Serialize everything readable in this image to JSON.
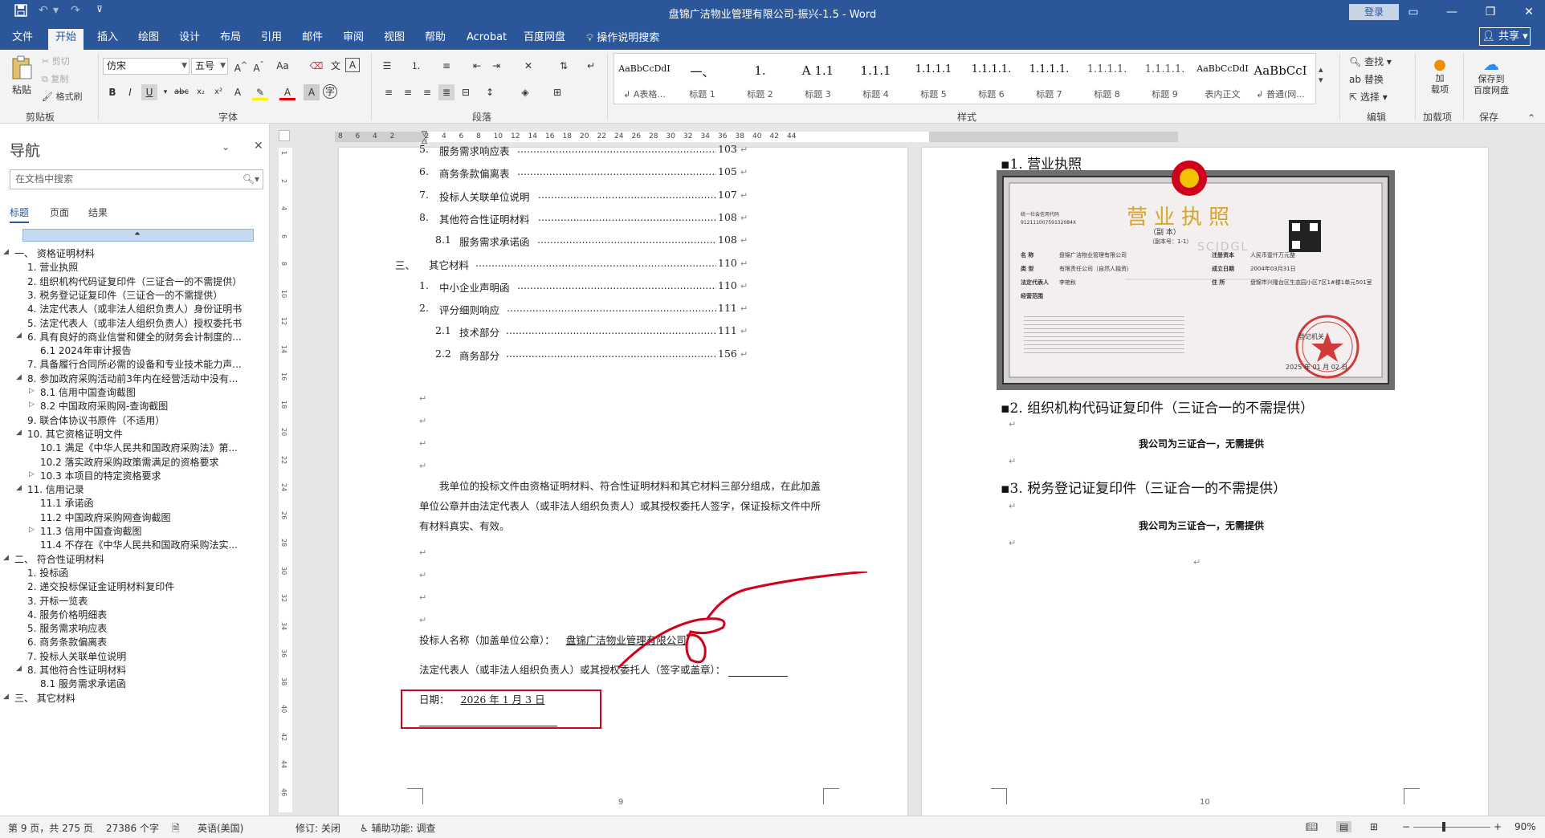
{
  "window": {
    "title": "盘锦广洁物业管理有限公司-振兴-1.5  -  Word",
    "login": "登录",
    "share": "共享"
  },
  "tabs": [
    "文件",
    "开始",
    "插入",
    "绘图",
    "设计",
    "布局",
    "引用",
    "邮件",
    "审阅",
    "视图",
    "帮助",
    "Acrobat",
    "百度网盘"
  ],
  "tell_me": "操作说明搜索",
  "ribbon": {
    "clipboard": {
      "paste": "粘贴",
      "cut": "剪切",
      "copy": "复制",
      "format_painter": "格式刷",
      "label": "剪贴板"
    },
    "font": {
      "name": "仿宋",
      "size": "五号",
      "label": "字体"
    },
    "paragraph": {
      "label": "段落"
    },
    "styles": {
      "label": "样式",
      "items": [
        {
          "preview": "AaBbCcDdI",
          "name": "↲ A表格..."
        },
        {
          "preview": "一、",
          "name": "标题 1"
        },
        {
          "preview": "1.",
          "name": "标题 2"
        },
        {
          "preview": "A 1.1",
          "name": "标题 3"
        },
        {
          "preview": "1.1.1",
          "name": "标题 4"
        },
        {
          "preview": "1.1.1.1",
          "name": "标题 5"
        },
        {
          "preview": "1.1.1.1.",
          "name": "标题 6"
        },
        {
          "preview": "1.1.1.1.",
          "name": "标题 7"
        },
        {
          "preview": "1.1.1.1.",
          "name": "标题 8"
        },
        {
          "preview": "1.1.1.1.",
          "name": "标题 9"
        },
        {
          "preview": "AaBbCcDdI",
          "name": "表内正文"
        },
        {
          "preview": "AaBbCcI",
          "name": "↲ 普通(网..."
        }
      ]
    },
    "editing": {
      "find": "查找",
      "replace": "替换",
      "select": "选择",
      "label": "编辑"
    },
    "addins": {
      "name": "加\n载项",
      "label": "加载项"
    },
    "save": {
      "name": "保存到\n百度网盘",
      "label": "保存"
    }
  },
  "nav": {
    "title": "导航",
    "search_placeholder": "在文档中搜索",
    "tabs": [
      "标题",
      "页面",
      "结果"
    ],
    "items": [
      {
        "text": "一、 资格证明材料",
        "level": 0,
        "expand": "down"
      },
      {
        "text": "1. 营业执照",
        "level": 1,
        "expand": ""
      },
      {
        "text": "2. 组织机构代码证复印件（三证合一的不需提供）",
        "level": 1,
        "expand": ""
      },
      {
        "text": "3. 税务登记证复印件（三证合一的不需提供）",
        "level": 1,
        "expand": ""
      },
      {
        "text": "4. 法定代表人（或非法人组织负责人）身份证明书",
        "level": 1,
        "expand": ""
      },
      {
        "text": "5. 法定代表人（或非法人组织负责人）授权委托书",
        "level": 1,
        "expand": ""
      },
      {
        "text": "6. 具有良好的商业信誉和健全的财务会计制度的...",
        "level": 1,
        "expand": "down"
      },
      {
        "text": "6.1 2024年审计报告",
        "level": 2,
        "expand": ""
      },
      {
        "text": "7. 具备履行合同所必需的设备和专业技术能力声...",
        "level": 1,
        "expand": ""
      },
      {
        "text": "8. 参加政府采购活动前3年内在经营活动中没有...",
        "level": 1,
        "expand": "down"
      },
      {
        "text": "8.1 信用中国查询截图",
        "level": 2,
        "expand": "right"
      },
      {
        "text": "8.2 中国政府采购网-查询截图",
        "level": 2,
        "expand": "right"
      },
      {
        "text": "9. 联合体协议书原件（不适用）",
        "level": 1,
        "expand": ""
      },
      {
        "text": "10. 其它资格证明文件",
        "level": 1,
        "expand": "down"
      },
      {
        "text": "10.1 满足《中华人民共和国政府采购法》第...",
        "level": 2,
        "expand": ""
      },
      {
        "text": "10.2 落实政府采购政策需满足的资格要求",
        "level": 2,
        "expand": ""
      },
      {
        "text": "10.3 本项目的特定资格要求",
        "level": 2,
        "expand": "right"
      },
      {
        "text": "11. 信用记录",
        "level": 1,
        "expand": "down"
      },
      {
        "text": "11.1 承诺函",
        "level": 2,
        "expand": ""
      },
      {
        "text": "11.2 中国政府采购网查询截图",
        "level": 2,
        "expand": ""
      },
      {
        "text": "11.3 信用中国查询截图",
        "level": 2,
        "expand": "right"
      },
      {
        "text": "11.4 不存在《中华人民共和国政府采购法实...",
        "level": 2,
        "expand": ""
      },
      {
        "text": "二、 符合性证明材料",
        "level": 0,
        "expand": "down"
      },
      {
        "text": "1. 投标函",
        "level": 1,
        "expand": ""
      },
      {
        "text": "2. 递交投标保证金证明材料复印件",
        "level": 1,
        "expand": ""
      },
      {
        "text": "3. 开标一览表",
        "level": 1,
        "expand": ""
      },
      {
        "text": "4. 服务价格明细表",
        "level": 1,
        "expand": ""
      },
      {
        "text": "5. 服务需求响应表",
        "level": 1,
        "expand": ""
      },
      {
        "text": "6. 商务条款偏离表",
        "level": 1,
        "expand": ""
      },
      {
        "text": "7. 投标人关联单位说明",
        "level": 1,
        "expand": ""
      },
      {
        "text": "8. 其他符合性证明材料",
        "level": 1,
        "expand": "down"
      },
      {
        "text": "8.1 服务需求承诺函",
        "level": 2,
        "expand": ""
      },
      {
        "text": "三、 其它材料",
        "level": 0,
        "expand": "down"
      }
    ]
  },
  "ruler": {
    "ticks": [
      "8",
      "6",
      "4",
      "2",
      "",
      "2",
      "4",
      "6",
      "8",
      "10",
      "12",
      "14",
      "16",
      "18",
      "20",
      "22",
      "24",
      "26",
      "28",
      "30",
      "32",
      "34",
      "36",
      "38",
      "40",
      "42",
      "44"
    ]
  },
  "vruler": {
    "ticks": [
      "1",
      "2",
      "4",
      "6",
      "8",
      "10",
      "12",
      "14",
      "16",
      "18",
      "20",
      "22",
      "24",
      "26",
      "28",
      "30",
      "32",
      "34",
      "36",
      "38",
      "40",
      "42",
      "44",
      "46"
    ]
  },
  "page9": {
    "toc": [
      {
        "num": "5.",
        "text": "服务需求响应表",
        "page": "103",
        "indent": 1
      },
      {
        "num": "6.",
        "text": "商务条款偏离表",
        "page": "105",
        "indent": 1
      },
      {
        "num": "7.",
        "text": "投标人关联单位说明",
        "page": "107",
        "indent": 1
      },
      {
        "num": "8.",
        "text": "其他符合性证明材料",
        "page": "108",
        "indent": 1
      },
      {
        "num": "8.1",
        "text": "服务需求承诺函",
        "page": "108",
        "indent": 2
      },
      {
        "num": "三、",
        "text": "其它材料",
        "page": "110",
        "indent": 0
      },
      {
        "num": "1.",
        "text": "中小企业声明函",
        "page": "110",
        "indent": 1
      },
      {
        "num": "2.",
        "text": "评分细则响应",
        "page": "111",
        "indent": 1
      },
      {
        "num": "2.1",
        "text": "技术部分",
        "page": "111",
        "indent": 2
      },
      {
        "num": "2.2",
        "text": "商务部分",
        "page": "156",
        "indent": 2
      }
    ],
    "statement": "我单位的投标文件由资格证明材料、符合性证明材料和其它材料三部分组成，在此加盖单位公章并由法定代表人（或非法人组织负责人）或其授权委托人签字，保证投标文件中所有材料真实、有效。",
    "bidder_label": "投标人名称（加盖单位公章）：",
    "bidder_value": "盘锦广洁物业管理有限公司",
    "rep_label": "法定代表人（或非法人组织负责人）或其授权委托人（签字或盖章）：",
    "date_label": "日期：",
    "date_value": "2026 年 1 月 3 日",
    "page_number": "9"
  },
  "page10": {
    "h1": "1. 营业执照",
    "license": {
      "title": "营业执照",
      "subtitle": "（副 本）",
      "copy_no": "（副本号：1-1）",
      "credit_code_label": "统一社会信用代码",
      "credit_code": "91211100759132084X",
      "fields": [
        {
          "k": "名    称",
          "v": "盘锦广洁物业管理有限公司"
        },
        {
          "k": "类    型",
          "v": "有限责任公司（自然人独资）"
        },
        {
          "k": "法定代表人",
          "v": "李艳秋"
        },
        {
          "k": "经营范围",
          "v": ""
        }
      ],
      "right_fields": [
        {
          "k": "注册资本",
          "v": "人民币壹仟万元整"
        },
        {
          "k": "成立日期",
          "v": "2004年03月31日"
        },
        {
          "k": "住    所",
          "v": "盘锦市兴隆台区生态园小区7区1#楼1单元501室"
        }
      ],
      "registrar": "登记机关",
      "date": "2025 年 01 月 02 日",
      "watermark": "SCJDGL",
      "stamp_text": "盘锦市兴隆台区市场监督管理局"
    },
    "h2": "2. 组织机构代码证复印件（三证合一的不需提供）",
    "note2": "我公司为三证合一，无需提供",
    "h3": "3. 税务登记证复印件（三证合一的不需提供）",
    "note3": "我公司为三证合一，无需提供",
    "page_number": "10"
  },
  "status": {
    "page": "第 9 页，共 275 页",
    "words": "27386 个字",
    "lang": "英语(美国)",
    "track": "修订: 关闭",
    "accessibility": "辅助功能: 调查",
    "zoom": "90%"
  },
  "colors": {
    "accent": "#2b579a",
    "annotation": "#d0021b",
    "stamp": "#d23a3a"
  }
}
